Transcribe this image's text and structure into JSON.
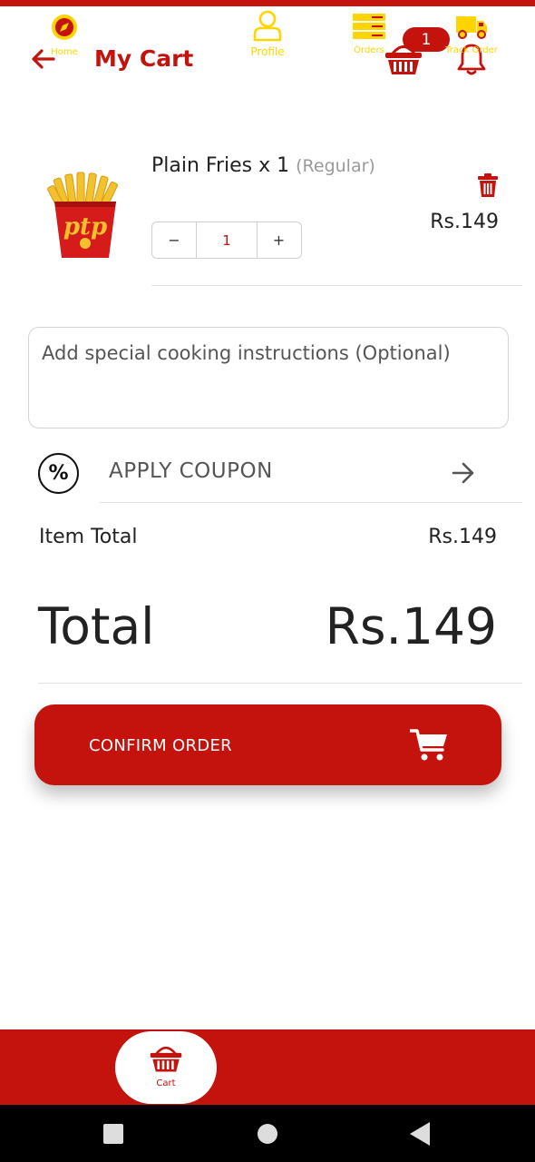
{
  "colors": {
    "brand_red": "#c4120d",
    "nav_yellow": "#ffd400",
    "text": "#222222"
  },
  "header": {
    "title": "My Cart",
    "cart_count": "1",
    "back_icon": "arrow-left-icon",
    "cart_icon": "basket-icon",
    "bell_icon": "bell-icon"
  },
  "cart_item": {
    "name": "Plain Fries x 1",
    "variant": "(Regular)",
    "price": "Rs.149",
    "quantity": "1",
    "minus_label": "−",
    "plus_label": "+",
    "image_icon": "fries-cup-image"
  },
  "instructions": {
    "placeholder": "Add special cooking instructions (Optional)"
  },
  "coupon": {
    "icon_text": "%",
    "label": "APPLY COUPON"
  },
  "totals": {
    "item_total_label": "Item Total",
    "item_total_value": "Rs.149",
    "total_label": "Total",
    "total_value": "Rs.149"
  },
  "confirm": {
    "label": "CONFIRM ORDER",
    "icon": "shopping-cart-icon"
  },
  "bottom_nav": {
    "items": [
      {
        "label": "Home",
        "icon": "compass-icon",
        "active": false
      },
      {
        "label": "Cart",
        "icon": "basket-icon",
        "active": true
      },
      {
        "label": "Profile",
        "icon": "person-icon",
        "active": false
      },
      {
        "label": "Orders",
        "icon": "orders-list-icon",
        "active": false
      },
      {
        "label": "Track Order",
        "icon": "delivery-truck-icon",
        "active": false
      }
    ]
  }
}
